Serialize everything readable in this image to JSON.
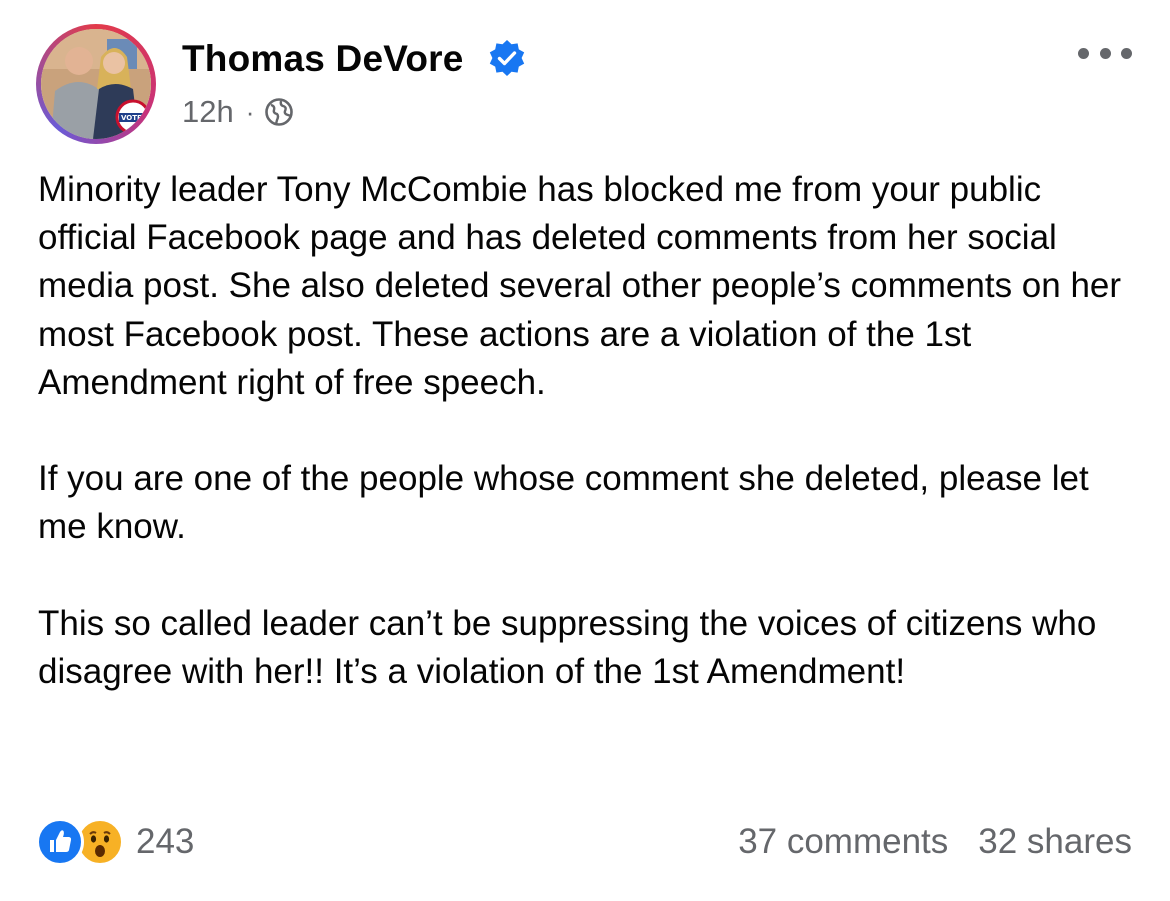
{
  "author": {
    "name": "Thomas DeVore",
    "verified": true,
    "avatar_badge_text": "VOTE!"
  },
  "meta": {
    "time": "12h",
    "separator": "·",
    "audience_icon": "globe-icon"
  },
  "post": {
    "paragraphs": [
      "Minority leader Tony McCombie has blocked me from your public official Facebook page and has deleted comments from her social media post.  She also deleted several other people’s comments on her most Facebook post. These actions are a violation of the 1st Amendment right of free speech.",
      "If you are one of the people whose comment she deleted, please let me know.",
      "This so called leader can’t be suppressing the voices of citizens who disagree with her!!  It’s a violation of the 1st Amendment!"
    ]
  },
  "footer": {
    "reaction_icons": [
      "like-icon",
      "wow-icon"
    ],
    "reaction_count": "243",
    "comments": "37 comments",
    "shares": "32 shares"
  },
  "colors": {
    "secondary_text": "#65676b",
    "like_blue": "#1877f2",
    "verified_blue": "#1877f2",
    "wow_yellow": "#f7b125"
  }
}
